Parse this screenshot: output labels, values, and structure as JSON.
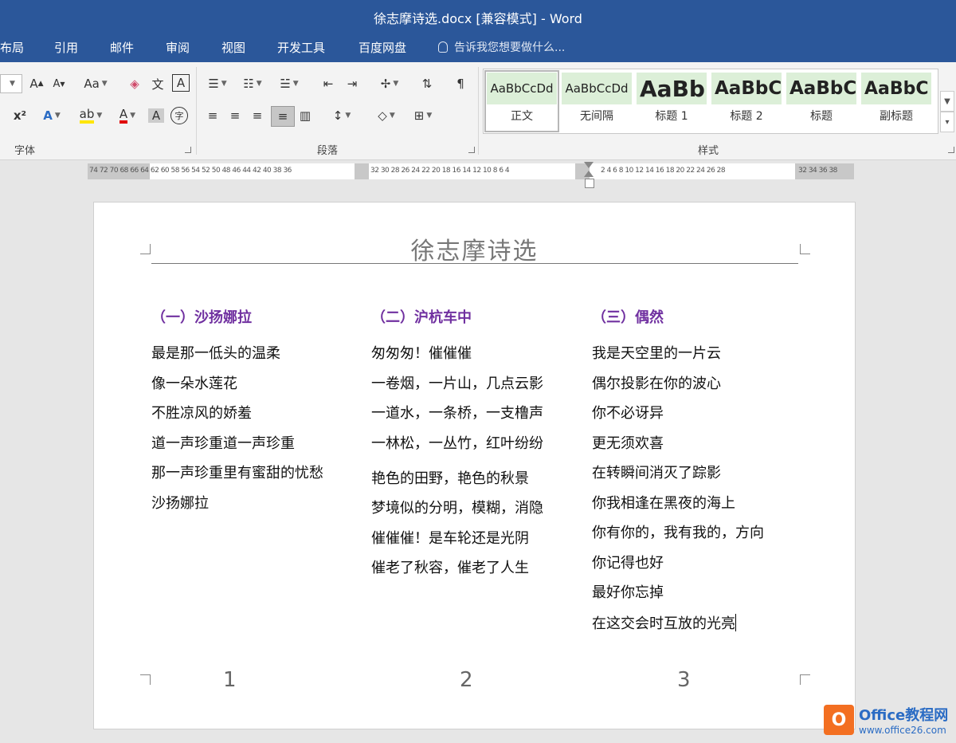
{
  "window": {
    "title": "徐志摩诗选.docx [兼容模式] - Word"
  },
  "menu": {
    "tabs": [
      "布局",
      "引用",
      "邮件",
      "审阅",
      "视图",
      "开发工具",
      "百度网盘"
    ],
    "tellme": "告诉我您想要做什么..."
  },
  "ribbon": {
    "font_group": "字体",
    "paragraph_group": "段落",
    "styles_group": "样式",
    "font_buttons": {
      "grow": "A",
      "shrink": "A",
      "change_case": "Aa",
      "pinyin": "文",
      "char_border": "A",
      "superscript": "x²",
      "text_effects": "A",
      "highlight": "ab",
      "font_color": "A",
      "char_shading": "A",
      "enclose": "字"
    },
    "styles": [
      {
        "preview": "AaBbCcDd",
        "name": "正文"
      },
      {
        "preview": "AaBbCcDd",
        "name": "无间隔"
      },
      {
        "preview": "AaBb",
        "name": "标题 1"
      },
      {
        "preview": "AaBbC",
        "name": "标题 2"
      },
      {
        "preview": "AaBbC",
        "name": "标题"
      },
      {
        "preview": "AaBbC",
        "name": "副标题"
      }
    ]
  },
  "ruler": {
    "left_numbers": "74 72 70 68 66 64 62 60 58 56 54 52 50 48 46 44 42 40 38 36",
    "middle_numbers": "32 30 28 26 24 22 20 18 16 14 12 10  8  6  4",
    "right_numbers": "2  4  6  8 10 12 14 16 18 20 22 24 26 28",
    "end_numbers": "32 34 36 38"
  },
  "document": {
    "title": "徐志摩诗选",
    "columns": [
      {
        "heading": "（一）沙扬娜拉",
        "lines": [
          "最是那一低头的温柔",
          "像一朵水莲花",
          "不胜凉风的娇羞",
          "道一声珍重道一声珍重",
          "那一声珍重里有蜜甜的忧愁",
          "沙扬娜拉"
        ],
        "page_number": "1"
      },
      {
        "heading": "（二）沪杭车中",
        "lines": [
          "匆匆匆！催催催",
          "一卷烟，一片山，几点云影",
          "一道水，一条桥，一支橹声",
          "一林松，一丛竹，红叶纷纷",
          "艳色的田野，艳色的秋景",
          "梦境似的分明，模糊，消隐",
          "催催催！是车轮还是光阴",
          "催老了秋容，催老了人生"
        ],
        "page_number": "2"
      },
      {
        "heading": "（三）偶然",
        "lines": [
          "我是天空里的一片云",
          "偶尔投影在你的波心",
          "你不必讶异",
          "更无须欢喜",
          "在转瞬间消灭了踪影",
          "你我相逢在黑夜的海上",
          "你有你的，我有我的，方向",
          "你记得也好",
          "最好你忘掉",
          "在这交会时互放的光亮"
        ],
        "page_number": "3"
      }
    ]
  },
  "watermark": {
    "logo": "O",
    "line1": "Office教程网",
    "line2": "www.office26.com"
  }
}
